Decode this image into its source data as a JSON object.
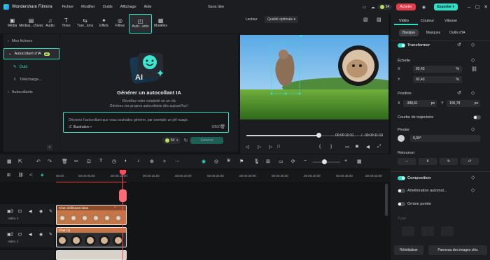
{
  "app": {
    "brand": "Wondershare Filmora",
    "document_title": "Sans titre"
  },
  "menu": [
    "Fichier",
    "Modifier",
    "Outils",
    "Affichage",
    "Aide"
  ],
  "header": {
    "buy_label": "Acheter",
    "credits": "54",
    "export_label": "Exporter"
  },
  "library_tabs": [
    {
      "label": "Média",
      "icon": "media-icon"
    },
    {
      "label": "Médias...chives",
      "icon": "archive-icon"
    },
    {
      "label": "Audio",
      "icon": "music-icon"
    },
    {
      "label": "Titres",
      "icon": "text-icon"
    },
    {
      "label": "Tran...ions",
      "icon": "transition-icon"
    },
    {
      "label": "Effets",
      "icon": "effects-icon"
    },
    {
      "label": "Filtres",
      "icon": "filter-icon"
    },
    {
      "label": "Auto...ants",
      "icon": "sticker-icon",
      "active": true
    },
    {
      "label": "Modèles",
      "icon": "template-icon"
    }
  ],
  "sidebar": {
    "items": [
      {
        "label": "Mes fichiers"
      },
      {
        "label": "Autocollant d'IA",
        "badge": "AI",
        "selected": true
      },
      {
        "label": "Outil"
      },
      {
        "label": "Télécharge..."
      },
      {
        "label": "Autocollants"
      }
    ]
  },
  "generator": {
    "title": "Générer un autocollant IA",
    "subtitle_1": "Réveillez votre créativité en un clic",
    "subtitle_2": "Générez vos propres autocollants dès aujourd'hui !",
    "placeholder": "Décrivez l'autocollant que vous souhaitez générer, par exemple un joli nuage.",
    "style": "Illustration",
    "counter": "0/500",
    "credits": "54",
    "generate_label": "Générer"
  },
  "preview": {
    "tab_player": "Lecteur",
    "quality": "Qualité optimale",
    "time_current": "00:00:10:31",
    "time_total": "00:00:11:10",
    "progress": 0.92
  },
  "properties": {
    "tabs": [
      "Vidéo",
      "Couleur",
      "Vitesse"
    ],
    "subtabs": [
      "Basique",
      "Masques",
      "Outils d'IA"
    ],
    "transform_label": "Transformer",
    "scale_label": "Échelle",
    "scale_x_axis": "X",
    "scale_x": "92,43",
    "scale_y_axis": "Y",
    "scale_y": "92,43",
    "unit_percent": "%",
    "position_label": "Position",
    "pos_x_axis": "X",
    "pos_x": "-388,61",
    "pos_y_axis": "Y",
    "pos_y": "100,78",
    "unit_px": "px",
    "path_label": "Courbe de trajectoire",
    "rotate_label": "Pivoter",
    "rotate_value": "0,00°",
    "flip_label": "Retourner",
    "composition_label": "Composition",
    "enhance_label": "Amélioration automat...",
    "shadow_label": "Ombre portée",
    "type_label": "Type",
    "reset_label": "Réinitialiser",
    "keyframe_label": "Panneau des images clés"
  },
  "timeline": {
    "ticks": [
      "00:00",
      "00:00:05:00",
      "00:00:10:00",
      "00:00:15:00",
      "00:00:20:00",
      "00:00:25:00",
      "00:00:30:00",
      "00:00:35:00",
      "00:00:40:00",
      "00:00:45:00",
      "00:00:50:00"
    ],
    "track_3": "Vidéo 3",
    "track_2": "Vidéo 2",
    "clip_3_label": "Chat vieillissant dans",
    "clip_2_label": "Chat (1)"
  },
  "colors": {
    "accent": "#2fe0c6",
    "buy": "#e23b4a",
    "playhead": "#ff4b5c",
    "clip": "#c87546"
  }
}
